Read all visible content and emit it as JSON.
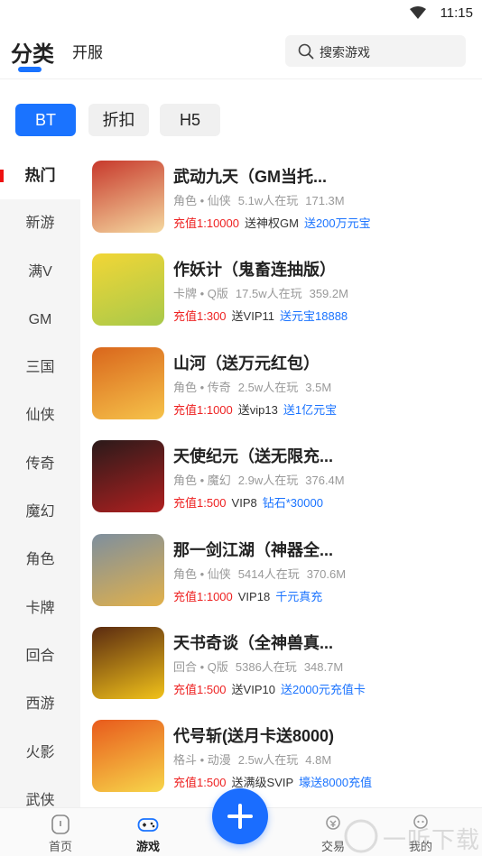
{
  "status_bar": {
    "time": "11:15",
    "wifi_icon": "wifi-icon"
  },
  "header": {
    "tabs": [
      {
        "label": "分类",
        "active": true
      },
      {
        "label": "开服",
        "active": false
      }
    ],
    "search": {
      "placeholder": "搜索游戏",
      "icon": "search-icon"
    }
  },
  "filters": [
    {
      "label": "BT",
      "active": true
    },
    {
      "label": "折扣",
      "active": false
    },
    {
      "label": "H5",
      "active": false
    }
  ],
  "sidebar": {
    "items": [
      {
        "label": "热门",
        "active": true
      },
      {
        "label": "新游"
      },
      {
        "label": "满V"
      },
      {
        "label": "GM"
      },
      {
        "label": "三国"
      },
      {
        "label": "仙侠"
      },
      {
        "label": "传奇"
      },
      {
        "label": "魔幻"
      },
      {
        "label": "角色"
      },
      {
        "label": "卡牌"
      },
      {
        "label": "回合"
      },
      {
        "label": "西游"
      },
      {
        "label": "火影"
      },
      {
        "label": "武侠"
      }
    ]
  },
  "games": [
    {
      "title": "武动九天（GM当托...",
      "genre": "角色 • 仙侠",
      "players": "5.1w人在玩",
      "size": "171.3M",
      "recharge": "充值1:10000",
      "perk": "送神权GM",
      "bonus": "送200万元宝",
      "thumb_colors": [
        "#c7392c",
        "#f5d9a0"
      ]
    },
    {
      "title": "作妖计（鬼畜连抽版）",
      "genre": "卡牌 • Q版",
      "players": "17.5w人在玩",
      "size": "359.2M",
      "recharge": "充值1:300",
      "perk": "送VIP11",
      "bonus": "送元宝18888",
      "thumb_colors": [
        "#f2d636",
        "#a8c94a"
      ]
    },
    {
      "title": "山河（送万元红包）",
      "genre": "角色 • 传奇",
      "players": "2.5w人在玩",
      "size": "3.5M",
      "recharge": "充值1:1000",
      "perk": "送vip13",
      "bonus": "送1亿元宝",
      "thumb_colors": [
        "#d9661c",
        "#f6c34a"
      ]
    },
    {
      "title": "天使纪元（送无限充...",
      "genre": "角色 • 魔幻",
      "players": "2.9w人在玩",
      "size": "376.4M",
      "recharge": "充值1:500",
      "perk": "VIP8",
      "bonus": "钻石*30000",
      "thumb_colors": [
        "#2a1a1a",
        "#b02020"
      ]
    },
    {
      "title": "那一剑江湖（神器全...",
      "genre": "角色 • 仙侠",
      "players": "5414人在玩",
      "size": "370.6M",
      "recharge": "充值1:1000",
      "perk": "VIP18",
      "bonus": "千元真充",
      "thumb_colors": [
        "#7e8f9e",
        "#e2b14a"
      ]
    },
    {
      "title": "天书奇谈（全神兽真...",
      "genre": "回合 • Q版",
      "players": "5386人在玩",
      "size": "348.7M",
      "recharge": "充值1:500",
      "perk": "送VIP10",
      "bonus": "送2000元充值卡",
      "thumb_colors": [
        "#5a2a10",
        "#f1c21a"
      ]
    },
    {
      "title": "代号斩(送月卡送8000)",
      "genre": "格斗 • 动漫",
      "players": "2.5w人在玩",
      "size": "4.8M",
      "recharge": "充值1:500",
      "perk": "送满级SVIP",
      "bonus": "壕送8000充值",
      "thumb_colors": [
        "#e85a1c",
        "#f7d64a"
      ]
    }
  ],
  "bottom_nav": [
    {
      "label": "首页",
      "icon": "home-icon"
    },
    {
      "label": "游戏",
      "icon": "gamepad-icon",
      "active": true
    },
    {
      "label": "交易",
      "icon": "trade-icon"
    },
    {
      "label": "我的",
      "icon": "profile-icon"
    }
  ],
  "fab": {
    "icon": "plus-icon"
  },
  "watermark": {
    "text": "一听下载"
  }
}
